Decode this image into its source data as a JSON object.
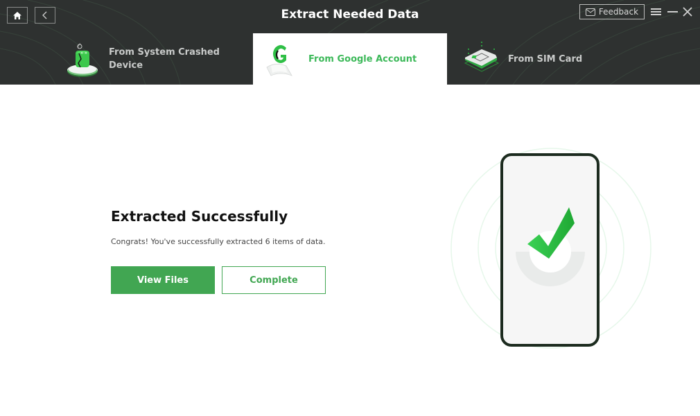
{
  "window": {
    "title": "Extract Needed Data",
    "feedback_label": "Feedback"
  },
  "icons": {
    "home": "home-icon",
    "back": "chevron-left-icon",
    "feedback": "mail-icon",
    "menu": "menu-icon",
    "minimize": "minimize-icon",
    "close": "close-icon"
  },
  "tabs": [
    {
      "label": "From System Crashed Device",
      "icon": "crashed-android-icon",
      "active": false
    },
    {
      "label": "From Google Account",
      "icon": "google-account-icon",
      "active": true
    },
    {
      "label": "From SIM Card",
      "icon": "sim-card-icon",
      "active": false
    }
  ],
  "main": {
    "title": "Extracted Successfully",
    "subtitle": "Congrats! You've successfully extracted 6 items of data.",
    "view_files_label": "View Files",
    "complete_label": "Complete"
  },
  "colors": {
    "accent": "#41a652",
    "header_bg": "#2e3130",
    "active_tab_text": "#3db95a"
  }
}
